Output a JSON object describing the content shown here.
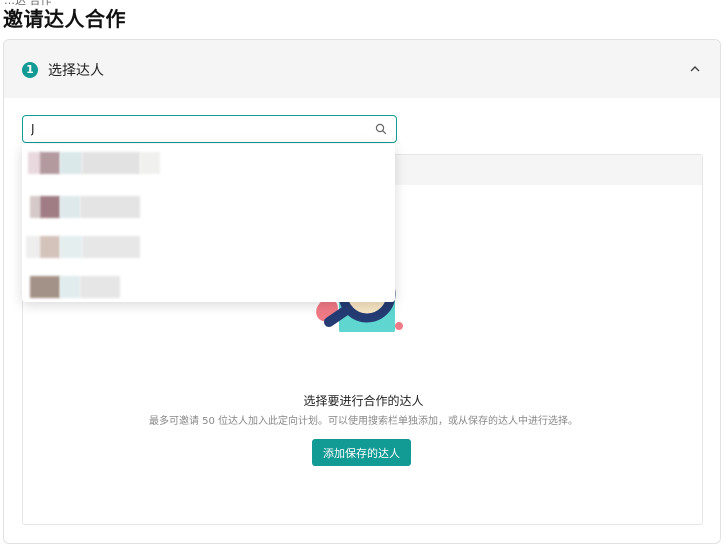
{
  "page": {
    "title": "邀请达人合作",
    "breadcrumb_partial": "…达 合作"
  },
  "step": {
    "number": "1",
    "title": "选择达人"
  },
  "search": {
    "value": "J",
    "placeholder": ""
  },
  "empty_state": {
    "title": "选择要进行合作的达人",
    "description": "最多可邀请 50 位达人加入此定向计划。可以使用搜索栏单独添加，或从保存的达人中进行选择。",
    "button_label": "添加保存的达人"
  },
  "colors": {
    "accent": "#129a94",
    "illustration_teal": "#5fd6d0",
    "illustration_navy": "#243b73",
    "illustration_pink": "#f07a85"
  }
}
